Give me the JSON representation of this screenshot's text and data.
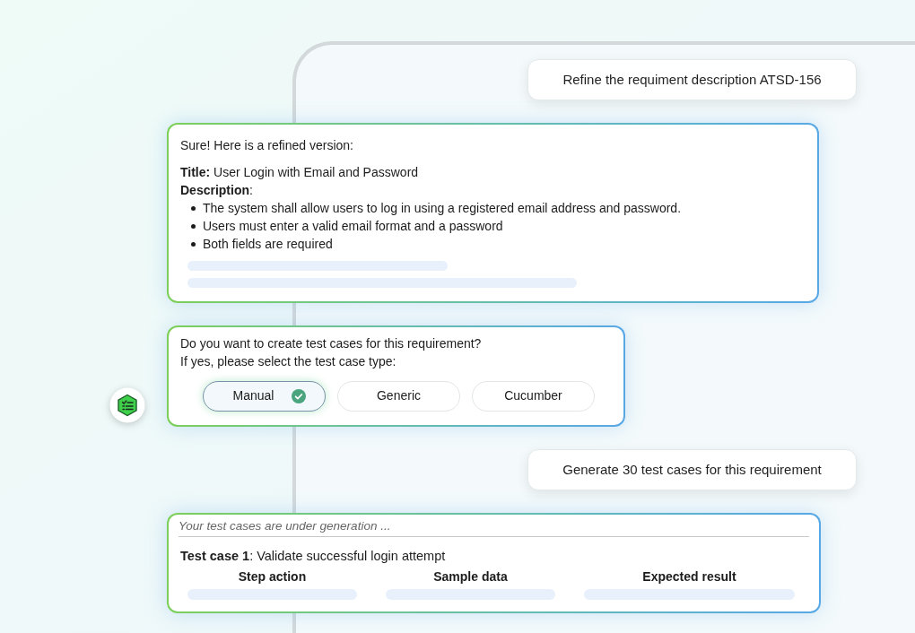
{
  "conversation": [
    {
      "kind": "user",
      "text": "Refine the requiment description ATSD-156"
    },
    {
      "kind": "refinement",
      "intro": "Sure! Here is a refined version:",
      "title_line": "**Title:** User Login with Email and Password",
      "description_heading": "**Description**:",
      "bullets": [
        "The system shall allow users to log in using a registered email address and password.",
        "Users must enter a valid email format and a password",
        "Both fields are required"
      ]
    },
    {
      "kind": "choice",
      "avatar": true,
      "question_lines": [
        "Do you want to create test cases for this requirement?",
        "If yes, please select the test case type:"
      ],
      "options": [
        {
          "label": "Manual",
          "selected": true
        },
        {
          "label": "Generic",
          "selected": false
        },
        {
          "label": "Cucumber",
          "selected": false
        }
      ]
    },
    {
      "kind": "user",
      "text": "Generate 30 test cases for this requirement"
    },
    {
      "kind": "generation",
      "status": "Your test cases are under generation ...",
      "test_case": "**Test case 1**: Validate successful login attempt",
      "columns": [
        "Step action",
        "Sample data",
        "Expected result"
      ]
    }
  ]
}
